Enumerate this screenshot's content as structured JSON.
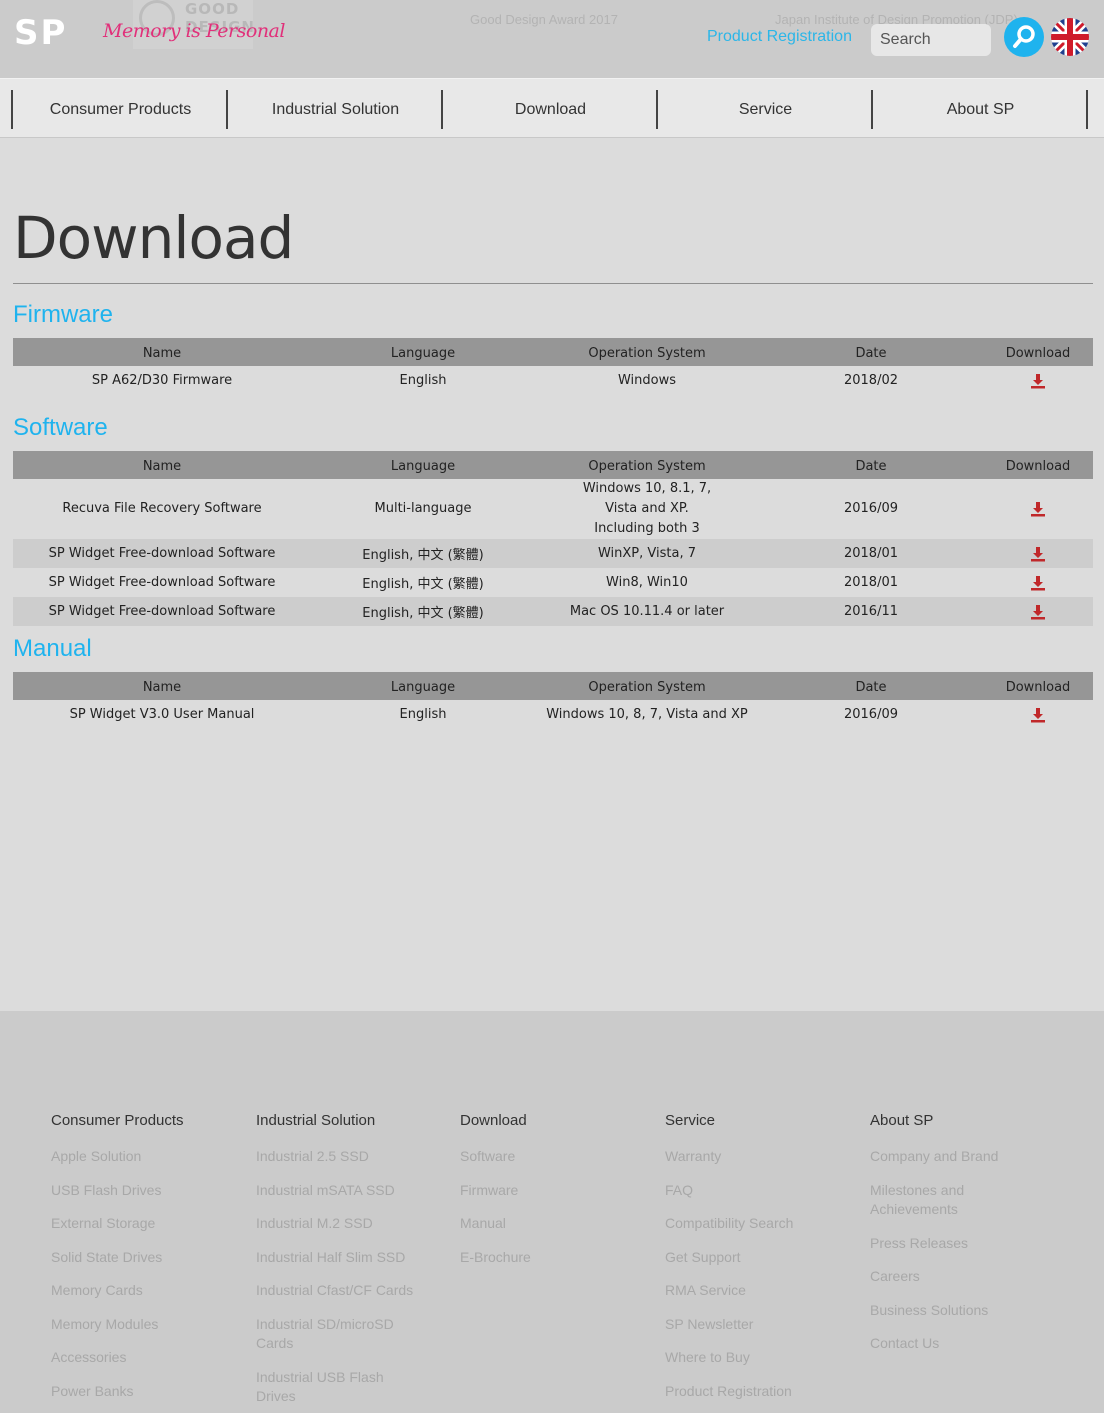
{
  "header": {
    "brand": "SP",
    "tagline": "Memory is Personal",
    "award_badge": "GOOD DESIGN",
    "award_text": "Good Design Award 2017",
    "award_org": "Japan Institute of Design Promotion (JDP)",
    "product_registration": "Product Registration",
    "search_placeholder": "Search",
    "search_icon": "search-icon",
    "language_icon": "uk-flag-icon"
  },
  "nav": {
    "items": [
      "Consumer Products",
      "Industrial Solution",
      "Download",
      "Service",
      "About SP"
    ]
  },
  "page": {
    "title": "Download"
  },
  "columns": {
    "name": "Name",
    "language": "Language",
    "os": "Operation System",
    "date": "Date",
    "download": "Download"
  },
  "sections": {
    "firmware": {
      "title": "Firmware",
      "rows": [
        {
          "name": "SP A62/D30 Firmware",
          "language": "English",
          "os": "Windows",
          "date": "2018/02"
        }
      ]
    },
    "software": {
      "title": "Software",
      "rows": [
        {
          "name": "Recuva File Recovery Software",
          "language": "Multi-language",
          "os": "Windows 10, 8.1, 7, Vista and XP. Including both 3",
          "date": "2016/09"
        },
        {
          "name": "SP Widget Free-download Software",
          "language": "English, 中文 (繁體)",
          "os": "WinXP, Vista, 7",
          "date": "2018/01"
        },
        {
          "name": "SP Widget Free-download Software",
          "language": "English, 中文 (繁體)",
          "os": "Win8, Win10",
          "date": "2018/01"
        },
        {
          "name": "SP Widget Free-download Software",
          "language": "English, 中文 (繁體)",
          "os": "Mac OS 10.11.4 or later",
          "date": "2016/11"
        }
      ]
    },
    "manual": {
      "title": "Manual",
      "rows": [
        {
          "name": "SP Widget V3.0 User Manual",
          "language": "English",
          "os": "Windows 10, 8, 7, Vista and XP",
          "date": "2016/09"
        }
      ]
    }
  },
  "footer": {
    "columns": [
      {
        "heading": "Consumer Products",
        "links": [
          "Apple Solution",
          "USB Flash Drives",
          "External Storage",
          "Solid State Drives",
          "Memory Cards",
          "Memory Modules",
          "Accessories",
          "Power Banks"
        ]
      },
      {
        "heading": "Industrial Solution",
        "links": [
          "Industrial 2.5 SSD",
          "Industrial mSATA SSD",
          "Industrial M.2 SSD",
          "Industrial Half Slim SSD",
          "Industrial Cfast/CF Cards",
          "Industrial SD/microSD Cards",
          "Industrial USB Flash Drives"
        ]
      },
      {
        "heading": "Download",
        "links": [
          "Software",
          "Firmware",
          "Manual",
          "E-Brochure"
        ]
      },
      {
        "heading": "Service",
        "links": [
          "Warranty",
          "FAQ",
          "Compatibility Search",
          "Get Support",
          "RMA Service",
          "SP Newsletter",
          "Where to Buy",
          "Product Registration"
        ]
      },
      {
        "heading": "About SP",
        "links": [
          "Company and Brand",
          "Milestones and Achievements",
          "Press Releases",
          "Careers",
          "Business Solutions",
          "Contact Us"
        ]
      }
    ]
  },
  "colors": {
    "accent": "#1fb3ee",
    "download_icon": "#c0282a",
    "tagline": "#e1307a"
  }
}
